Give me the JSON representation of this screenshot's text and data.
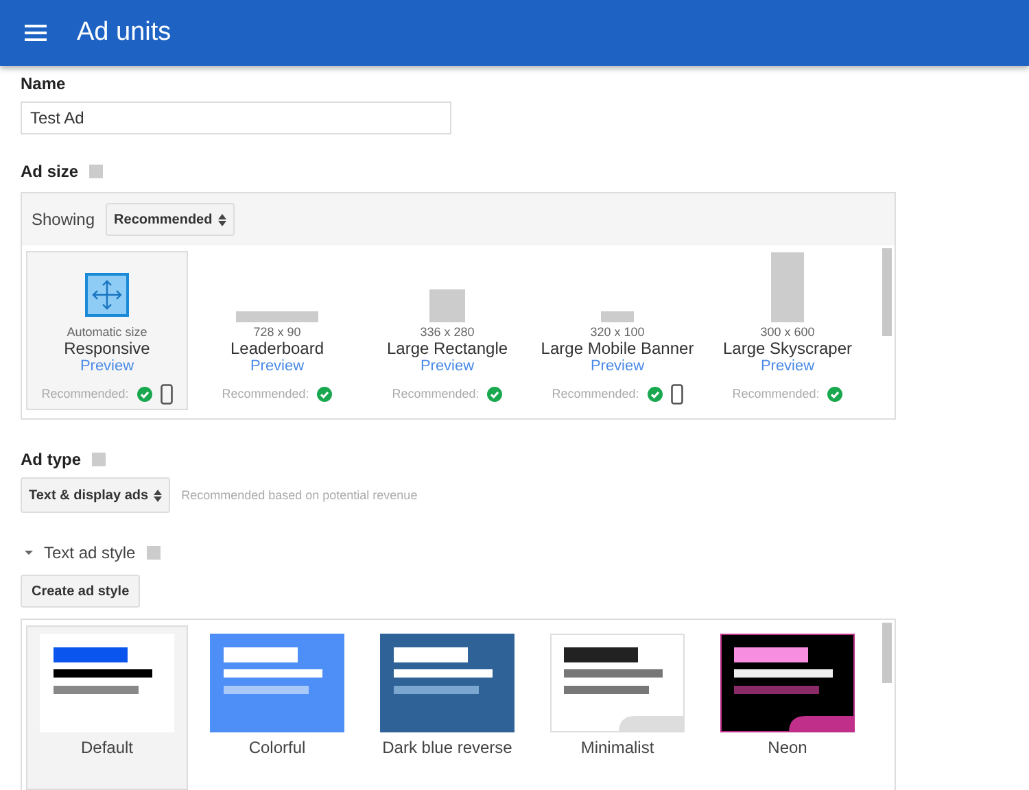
{
  "header": {
    "title": "Ad units"
  },
  "name_field": {
    "label": "Name",
    "value": "Test Ad"
  },
  "ad_size": {
    "label": "Ad size",
    "showing_label": "Showing",
    "showing_value": "Recommended",
    "sizes": [
      {
        "kind": "responsive",
        "dims": "Automatic size",
        "name": "Responsive",
        "preview": "Preview",
        "recommended": "Recommended:",
        "mobile": true,
        "selected": true
      },
      {
        "kind": "wide",
        "dims": "728 x 90",
        "name": "Leaderboard",
        "preview": "Preview",
        "recommended": "Recommended:",
        "mobile": false,
        "selected": false
      },
      {
        "kind": "square",
        "dims": "336 x 280",
        "name": "Large Rectangle",
        "preview": "Preview",
        "recommended": "Recommended:",
        "mobile": false,
        "selected": false
      },
      {
        "kind": "small",
        "dims": "320 x 100",
        "name": "Large Mobile Banner",
        "preview": "Preview",
        "recommended": "Recommended:",
        "mobile": true,
        "selected": false
      },
      {
        "kind": "tall",
        "dims": "300 x 600",
        "name": "Large Skyscraper",
        "preview": "Preview",
        "recommended": "Recommended:",
        "mobile": false,
        "selected": false
      }
    ]
  },
  "ad_type": {
    "label": "Ad type",
    "value": "Text & display ads",
    "note": "Recommended based on potential revenue"
  },
  "text_ad_style": {
    "label": "Text ad style",
    "expanded": true,
    "create_button": "Create ad style",
    "styles": [
      {
        "kind": "default",
        "name": "Default",
        "selected": true
      },
      {
        "kind": "colorful",
        "name": "Colorful",
        "selected": false
      },
      {
        "kind": "darkblue",
        "name": "Dark blue reverse",
        "selected": false
      },
      {
        "kind": "minimalist",
        "name": "Minimalist",
        "selected": false
      },
      {
        "kind": "neon",
        "name": "Neon",
        "selected": false
      }
    ]
  }
}
